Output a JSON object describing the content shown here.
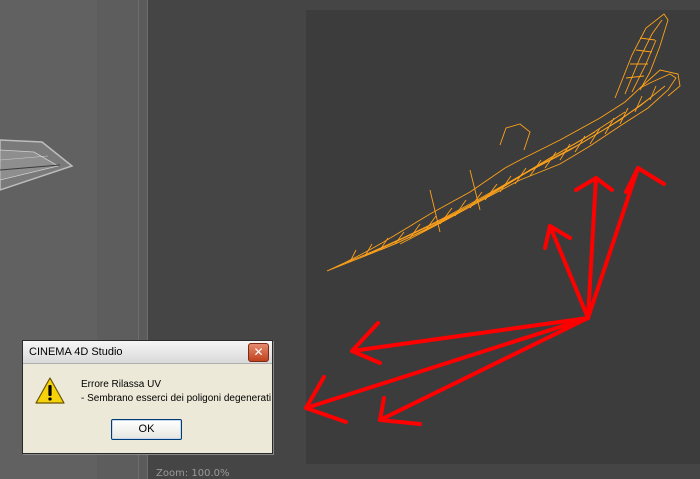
{
  "viewport": {
    "zoom_label": "Zoom: 100.0%"
  },
  "dialog": {
    "title": "CINEMA 4D Studio",
    "close_symbol": "✕",
    "icon": "warning-icon",
    "message_line1": "Errore Rilassa UV",
    "message_line2": "- Sembrano esserci dei poligoni degenerati",
    "ok_label": "OK"
  },
  "colors": {
    "wireframe": "#ffa21a",
    "annotation_arrows": "#ff0000",
    "uv_background": "#3c3c3c"
  }
}
